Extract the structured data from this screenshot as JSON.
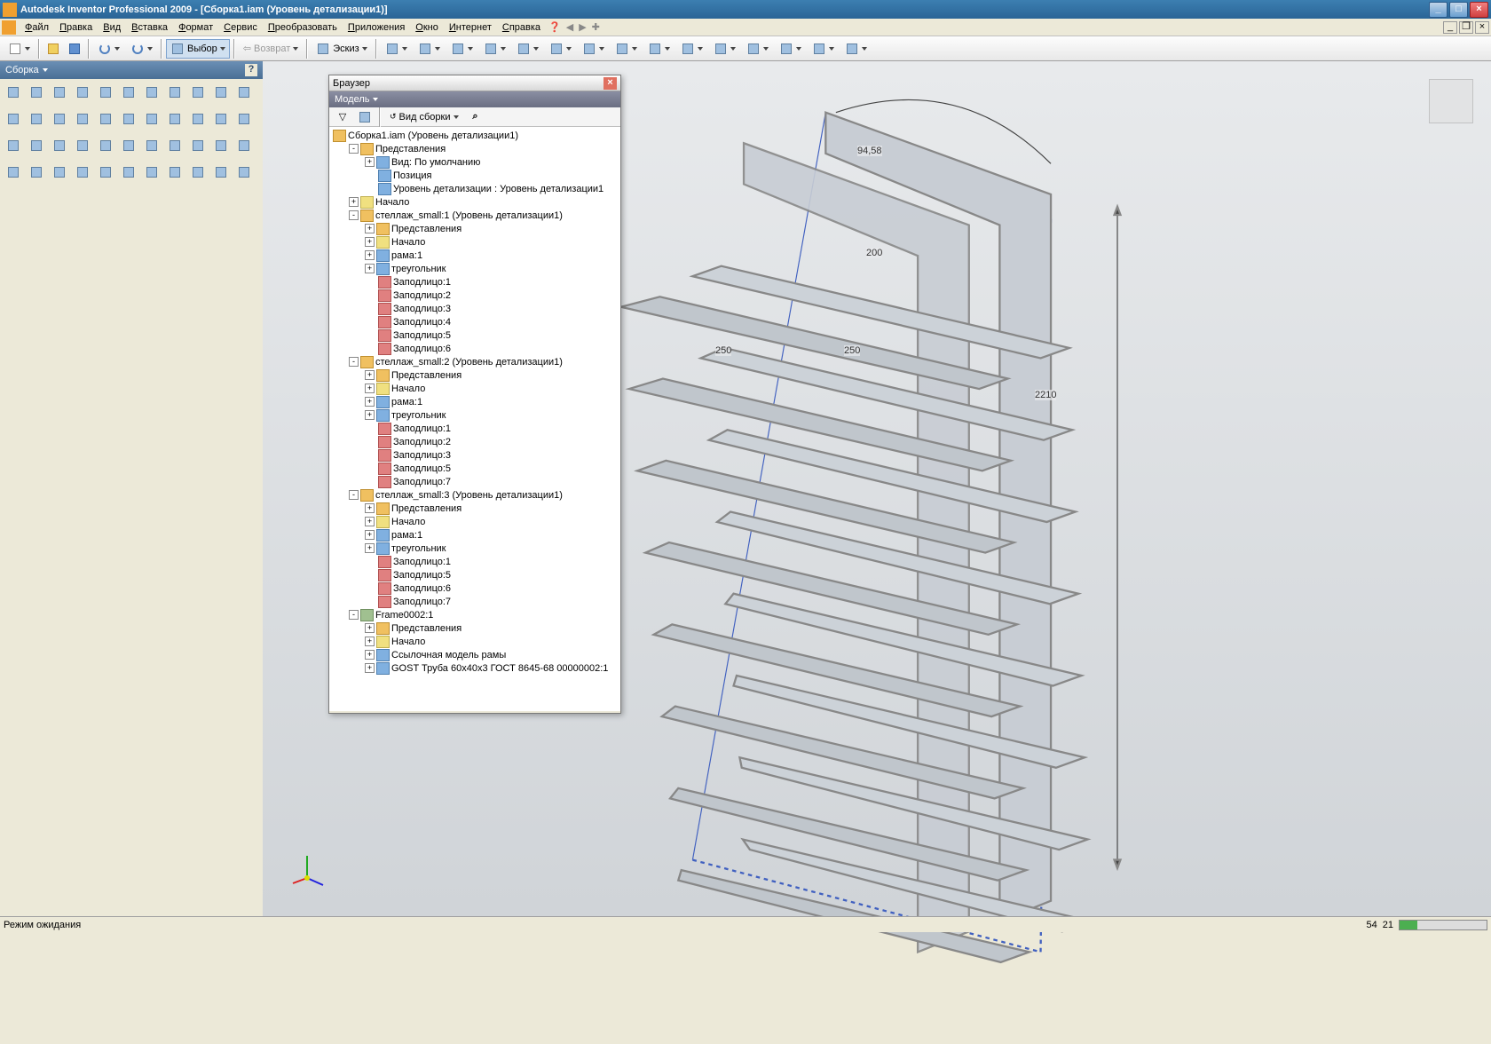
{
  "window": {
    "title": "Autodesk Inventor Professional 2009 - [Сборка1.iam (Уровень детализации1)]"
  },
  "menu": {
    "items": [
      "Файл",
      "Правка",
      "Вид",
      "Вставка",
      "Формат",
      "Сервис",
      "Преобразовать",
      "Приложения",
      "Окно",
      "Интернет",
      "Справка"
    ]
  },
  "toolbar": {
    "select_label": "Выбор",
    "return_label": "Возврат",
    "sketch_label": "Эскиз"
  },
  "sidebar": {
    "title": "Сборка"
  },
  "browser": {
    "title": "Браузер",
    "model_label": "Модель",
    "view_label": "Вид сборки",
    "root": "Сборка1.iam (Уровень детализации1)",
    "nodes": [
      {
        "d": 1,
        "e": "-",
        "i": "assy",
        "t": "Представления"
      },
      {
        "d": 2,
        "e": "+",
        "i": "part",
        "t": "Вид: По умолчанию"
      },
      {
        "d": 2,
        "e": "",
        "i": "part",
        "t": "Позиция"
      },
      {
        "d": 2,
        "e": "",
        "i": "part",
        "t": "Уровень детализации : Уровень детализации1"
      },
      {
        "d": 1,
        "e": "+",
        "i": "fold",
        "t": "Начало"
      },
      {
        "d": 1,
        "e": "-",
        "i": "assy",
        "t": "стеллаж_small:1 (Уровень детализации1)"
      },
      {
        "d": 2,
        "e": "+",
        "i": "assy",
        "t": "Представления"
      },
      {
        "d": 2,
        "e": "+",
        "i": "fold",
        "t": "Начало"
      },
      {
        "d": 2,
        "e": "+",
        "i": "part",
        "t": "рама:1"
      },
      {
        "d": 2,
        "e": "+",
        "i": "part",
        "t": "треугольник"
      },
      {
        "d": 2,
        "e": "",
        "i": "con",
        "t": "Заподлицо:1"
      },
      {
        "d": 2,
        "e": "",
        "i": "con",
        "t": "Заподлицо:2"
      },
      {
        "d": 2,
        "e": "",
        "i": "con",
        "t": "Заподлицо:3"
      },
      {
        "d": 2,
        "e": "",
        "i": "con",
        "t": "Заподлицо:4"
      },
      {
        "d": 2,
        "e": "",
        "i": "con",
        "t": "Заподлицо:5"
      },
      {
        "d": 2,
        "e": "",
        "i": "con",
        "t": "Заподлицо:6"
      },
      {
        "d": 1,
        "e": "-",
        "i": "assy",
        "t": "стеллаж_small:2 (Уровень детализации1)"
      },
      {
        "d": 2,
        "e": "+",
        "i": "assy",
        "t": "Представления"
      },
      {
        "d": 2,
        "e": "+",
        "i": "fold",
        "t": "Начало"
      },
      {
        "d": 2,
        "e": "+",
        "i": "part",
        "t": "рама:1"
      },
      {
        "d": 2,
        "e": "+",
        "i": "part",
        "t": "треугольник"
      },
      {
        "d": 2,
        "e": "",
        "i": "con",
        "t": "Заподлицо:1"
      },
      {
        "d": 2,
        "e": "",
        "i": "con",
        "t": "Заподлицо:2"
      },
      {
        "d": 2,
        "e": "",
        "i": "con",
        "t": "Заподлицо:3"
      },
      {
        "d": 2,
        "e": "",
        "i": "con",
        "t": "Заподлицо:5"
      },
      {
        "d": 2,
        "e": "",
        "i": "con",
        "t": "Заподлицо:7"
      },
      {
        "d": 1,
        "e": "-",
        "i": "assy",
        "t": "стеллаж_small:3 (Уровень детализации1)"
      },
      {
        "d": 2,
        "e": "+",
        "i": "assy",
        "t": "Представления"
      },
      {
        "d": 2,
        "e": "+",
        "i": "fold",
        "t": "Начало"
      },
      {
        "d": 2,
        "e": "+",
        "i": "part",
        "t": "рама:1"
      },
      {
        "d": 2,
        "e": "+",
        "i": "part",
        "t": "треугольник"
      },
      {
        "d": 2,
        "e": "",
        "i": "con",
        "t": "Заподлицо:1"
      },
      {
        "d": 2,
        "e": "",
        "i": "con",
        "t": "Заподлицо:5"
      },
      {
        "d": 2,
        "e": "",
        "i": "con",
        "t": "Заподлицо:6"
      },
      {
        "d": 2,
        "e": "",
        "i": "con",
        "t": "Заподлицо:7"
      },
      {
        "d": 1,
        "e": "-",
        "i": "frm",
        "t": "Frame0002:1"
      },
      {
        "d": 2,
        "e": "+",
        "i": "assy",
        "t": "Представления"
      },
      {
        "d": 2,
        "e": "+",
        "i": "fold",
        "t": "Начало"
      },
      {
        "d": 2,
        "e": "+",
        "i": "part",
        "t": "Ссылочная модель рамы"
      },
      {
        "d": 2,
        "e": "+",
        "i": "part",
        "t": "GOST Труба 60x40x3 ГОСТ 8645-68 00000002:1"
      }
    ]
  },
  "dimensions": {
    "angle": "94,58",
    "d200": "200",
    "d250a": "250",
    "d250b": "250",
    "height": "2210"
  },
  "status": {
    "text": "Режим ожидания",
    "n1": "54",
    "n2": "21"
  }
}
